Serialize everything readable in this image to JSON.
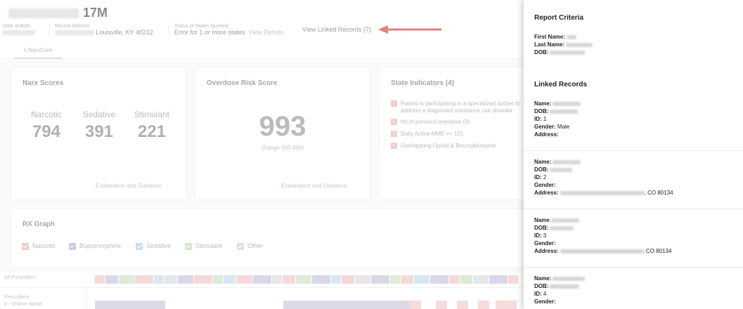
{
  "patient": {
    "age_sex": "17M",
    "dob_label": "Date of Birth:",
    "address_label": "Recent Address:",
    "address_visible": "Louisville, KY 40212",
    "status_label": "Status of States Queried:",
    "status_text": "Error for 1 or more states.",
    "view_details": "View Details",
    "view_linked": "View Linked Records (7)"
  },
  "tab": {
    "label": "NarxCare"
  },
  "narx_scores": {
    "title": "Narx Scores",
    "scores": [
      {
        "label": "Narcotic",
        "value": "794"
      },
      {
        "label": "Sedative",
        "value": "391"
      },
      {
        "label": "Stimulant",
        "value": "221"
      }
    ],
    "guidance": "Explanation and Guidance"
  },
  "overdose": {
    "title": "Overdose Risk Score",
    "value": "993",
    "range": "(Range 000-999)",
    "guidance": "Explanation and Guidance"
  },
  "state_indicators": {
    "title": "State Indicators (4)",
    "items": [
      "Patient is participating in a specialized docket to address a diagnosed substance use disorder.",
      "Hx of previous overdose (3)",
      "Daily Active MME >= 115",
      "Overlapping Opioid & Benzodiazepine"
    ]
  },
  "rx_graph": {
    "title": "RX Graph",
    "legend": [
      {
        "label": "Narcotic",
        "color": "#e9a6a6"
      },
      {
        "label": "Buprenorphine",
        "color": "#a9a3c9"
      },
      {
        "label": "Sedative",
        "color": "#a6cbe0"
      },
      {
        "label": "Stimulant",
        "color": "#b3d4a3"
      },
      {
        "label": "Other",
        "color": "#c8c8c8"
      }
    ],
    "all_prescribers": "All Prescribers",
    "prescribers": "Prescribers",
    "prescriber_1": "8 - Sharon Marsh"
  },
  "panel": {
    "criteria_title": "Report Criteria",
    "first_name": "First Name:",
    "last_name": "Last Name:",
    "dob": "DOB:",
    "linked_title": "Linked Records",
    "name_lbl": "Name:",
    "name_lbl_nocolon": "Name",
    "dob_lbl": "DOB:",
    "id_lbl": "ID:",
    "gender_lbl": "Gender:",
    "address_lbl": "Address:",
    "records": [
      {
        "id": "1",
        "gender": "Male",
        "address_tail": ""
      },
      {
        "id": "2",
        "gender": "",
        "address_tail": ", CO 80134"
      },
      {
        "id": "3",
        "gender": "",
        "address_tail": "CO 80134"
      },
      {
        "id": "4",
        "gender": "",
        "address_tail": ""
      }
    ]
  }
}
